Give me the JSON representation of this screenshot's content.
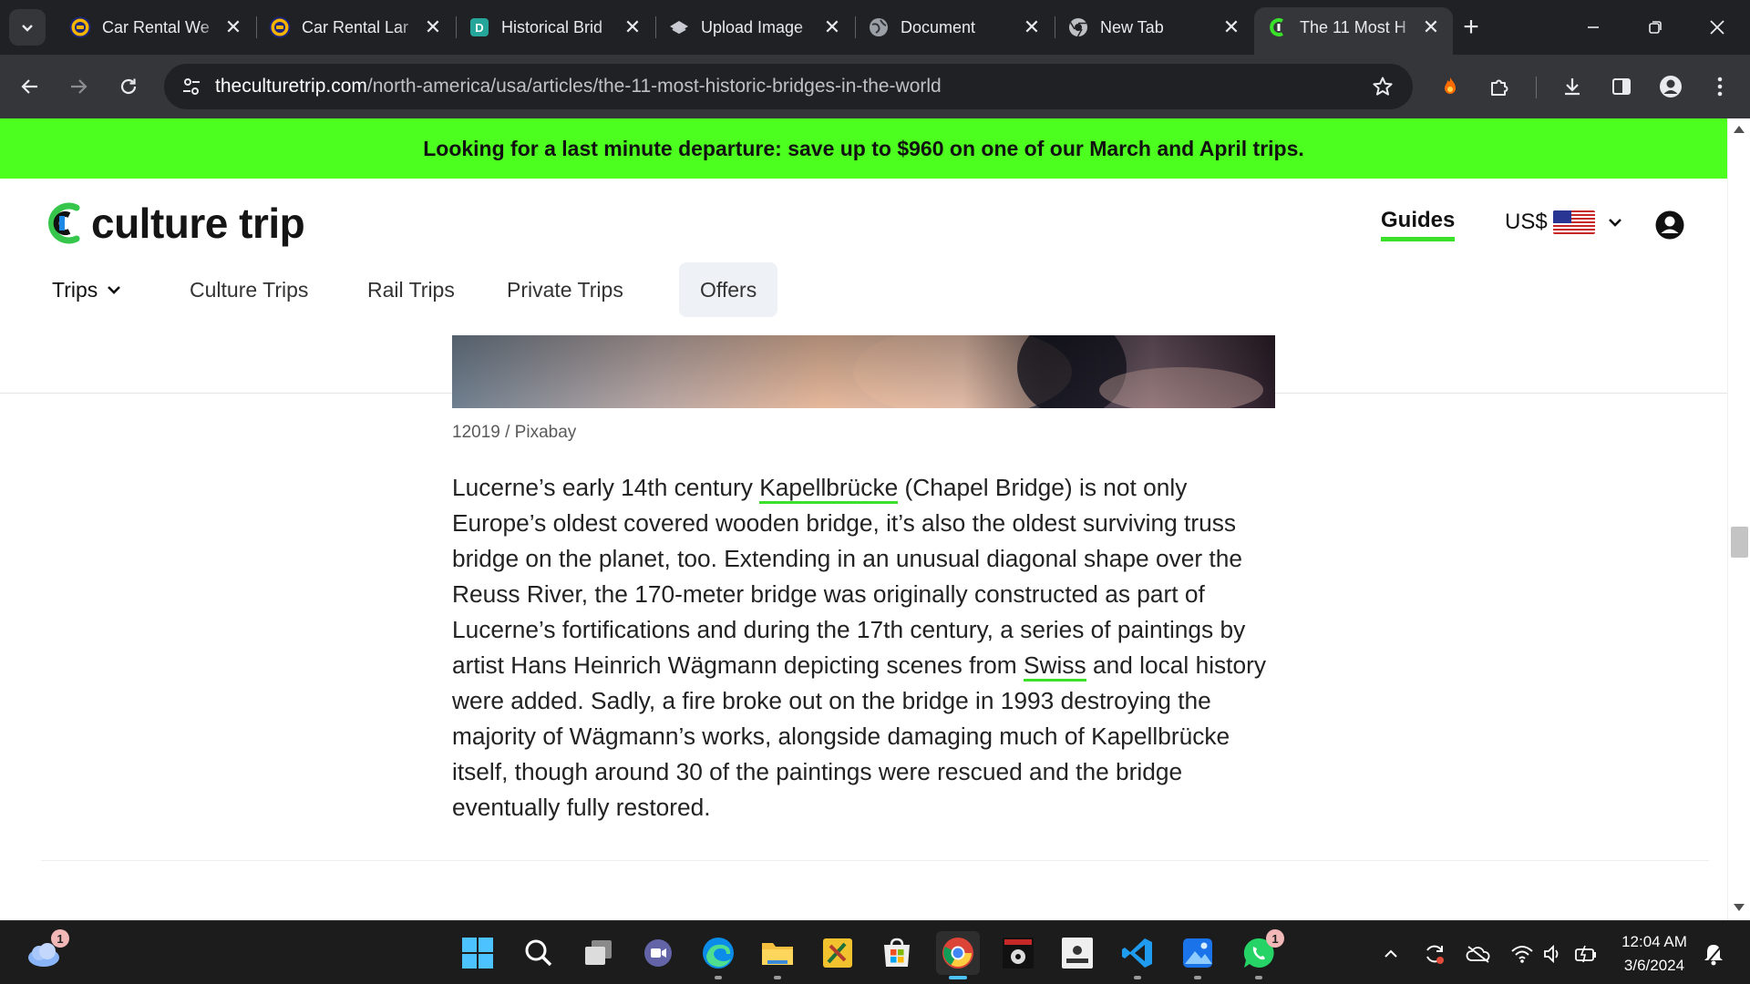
{
  "browser": {
    "tabs": [
      {
        "title": "Car Rental We",
        "icon": "car-rental-favicon"
      },
      {
        "title": "Car Rental Lar",
        "icon": "car-rental-favicon"
      },
      {
        "title": "Historical Brid",
        "icon": "document-favicon"
      },
      {
        "title": "Upload Image",
        "icon": "upload-favicon"
      },
      {
        "title": "Document",
        "icon": "globe-favicon"
      },
      {
        "title": "New Tab",
        "icon": "chrome-favicon"
      },
      {
        "title": "The 11 Most H",
        "icon": "culture-trip-favicon",
        "active": true
      }
    ],
    "url_host": "theculturetrip.com",
    "url_path": "/north-america/usa/articles/the-11-most-historic-bridges-in-the-world"
  },
  "promo": {
    "text": "Looking for a last minute departure: save up to $960 on one of our March and April trips."
  },
  "header": {
    "logo_text": "culture trip",
    "guides": "Guides",
    "currency": "US$"
  },
  "nav": {
    "trips": "Trips",
    "culture_trips": "Culture Trips",
    "rail_trips": "Rail Trips",
    "private_trips": "Private Trips",
    "offers": "Offers"
  },
  "article": {
    "caption": "12019 / Pixabay",
    "p1": "Lucerne’s early 14th century ",
    "link1": "Kapellbrücke",
    "p2": " (Chapel Bridge) is not only Europe’s oldest covered wooden bridge, it’s also the oldest surviving truss bridge on the planet, too. Extending in an unusual diagonal shape over the Reuss River, the 170-meter bridge was originally constructed as part of Lucerne’s fortifications and during the 17th century, a series of paintings by artist Hans Heinrich Wägmann depicting scenes from ",
    "link2": "Swiss",
    "p3": " and local history were added. Sadly, a fire broke out on the bridge in 1993 destroying the majority of Wägmann’s works, alongside damaging much of Kapellbrücke itself, though around 30 of the paintings were rescued and the bridge eventually fully restored."
  },
  "taskbar": {
    "weather_badge": "1",
    "whatsapp_badge": "1",
    "time": "12:04 AM",
    "date": "3/6/2024"
  },
  "colors": {
    "promo_bg": "#4cff1f",
    "link_underline": "#3be02a",
    "chrome_dark": "#202124",
    "chrome_toolbar": "#35363a"
  }
}
